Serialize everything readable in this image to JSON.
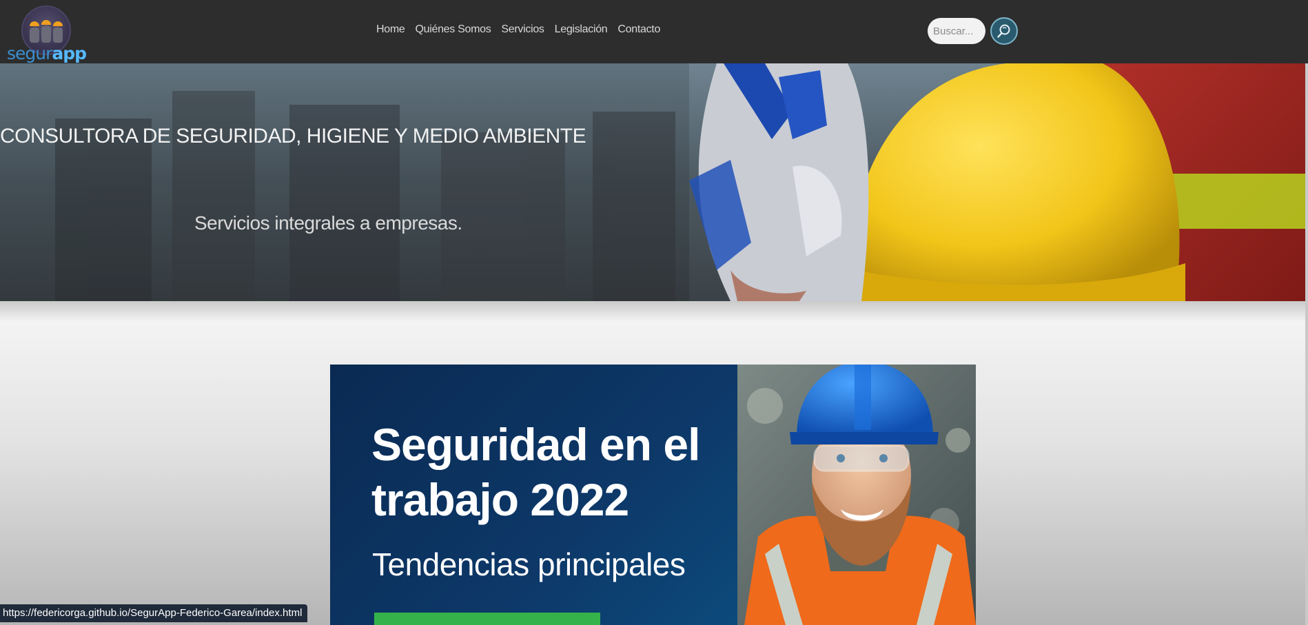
{
  "navbar": {
    "logo": {
      "text_a": "segur",
      "text_b": "app"
    },
    "links": [
      {
        "label": "Home"
      },
      {
        "label": "Quiénes Somos"
      },
      {
        "label": "Servicios"
      },
      {
        "label": "Legislación"
      },
      {
        "label": "Contacto"
      }
    ],
    "search": {
      "placeholder": "Buscar...",
      "value": "",
      "button_icon": "search-icon"
    }
  },
  "hero": {
    "title": "CONSULTORA DE SEGURIDAD, HIGIENE Y MEDIO AMBIENTE",
    "subtitle": "Servicios integrales a empresas."
  },
  "banner": {
    "title_line1": "Seguridad en el",
    "title_line2": "trabajo 2022",
    "subtitle": "Tendencias principales",
    "accent_color": "#35b34a"
  },
  "status_bar": {
    "url": "https://federicorga.github.io/SegurApp-Federico-Garea/index.html"
  },
  "colors": {
    "navbar_bg": "#2d2d2d",
    "banner_bg": "#0d3868",
    "hardhat_yellow": "#f2c519",
    "worker_helmet_blue": "#1b6fd6"
  }
}
